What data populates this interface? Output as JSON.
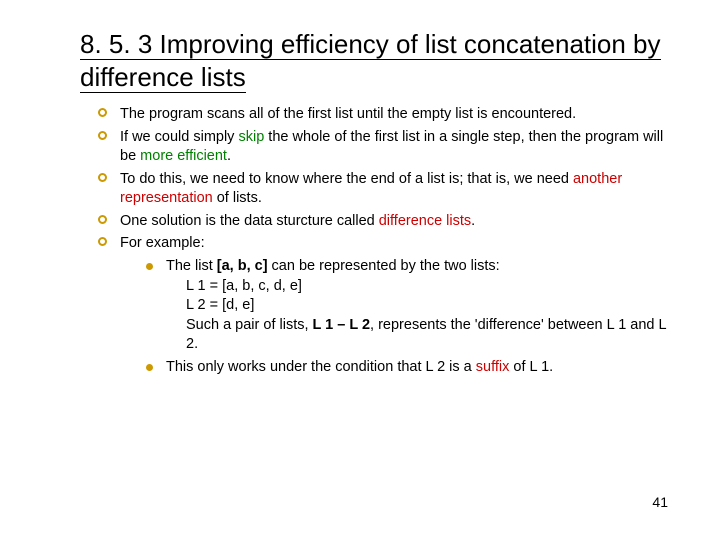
{
  "title": "8. 5. 3 Improving efficiency of list concatenation by difference lists",
  "b1a": "The program scans all of the first list until the empty list is encountered.",
  "b2a": "If we could simply ",
  "b2skip": "skip",
  "b2b": " the whole of the first list in a single step, then the program will be ",
  "b2eff": "more efficient",
  "b2c": ".",
  "b3a": "To do this, we need to know where the end of a list is; that is, we need ",
  "b3rep": "another representation",
  "b3b": " of lists.",
  "b4a": "One solution is the data sturcture called ",
  "b4diff": "difference lists",
  "b4b": ".",
  "b5a": "For example:",
  "s1a": "The list ",
  "s1abc": "[a, b, c]",
  "s1b": " can be represented by the two lists:",
  "s1l1": "L 1 = [a, b, c, d, e]",
  "s1l2": "L 2 = [d, e]",
  "s1p2a": " Such a pair of lists, ",
  "s1p2b": "L 1 – L 2",
  "s1p2c": ", represents the 'difference' between L 1 and L 2.",
  "s2a": "This only works under the condition that L 2 is a ",
  "s2suf": "suffix",
  "s2b": " of L 1.",
  "pagenum": "41"
}
